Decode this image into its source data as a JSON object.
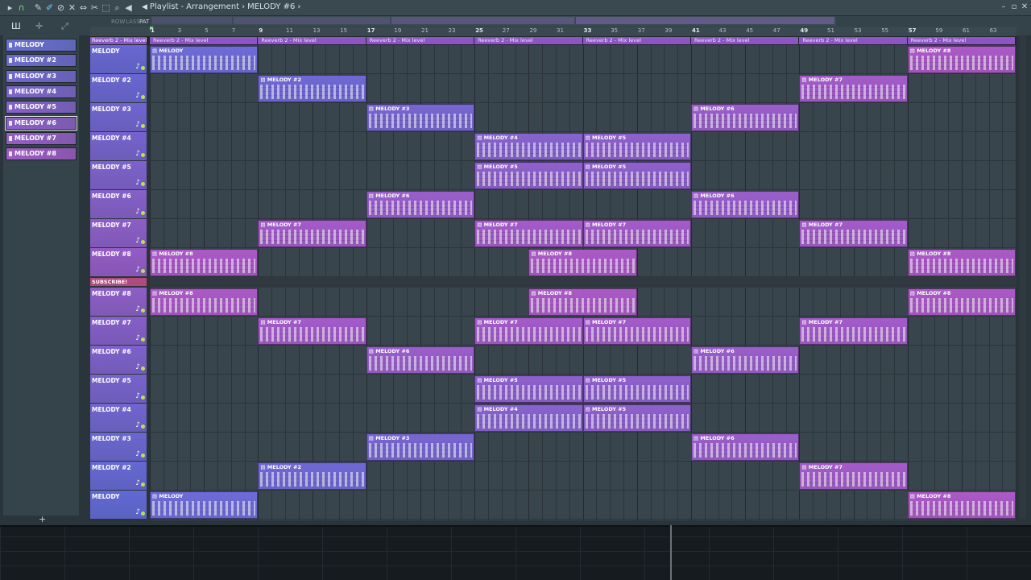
{
  "breadcrumb": {
    "part1": "Playlist",
    "part2": "Arrangement",
    "part3": "MELODY #6"
  },
  "toolbar_labels": {
    "row1a": "ROW",
    "row1b": "LASS",
    "row1c": "PAT"
  },
  "patterns": [
    {
      "label": "MELODY",
      "color": "#6a6fd2"
    },
    {
      "label": "MELODY #2",
      "color": "#6d6bd0"
    },
    {
      "label": "MELODY #3",
      "color": "#7468cf"
    },
    {
      "label": "MELODY #4",
      "color": "#7c66cc"
    },
    {
      "label": "MELODY #5",
      "color": "#8463ca"
    },
    {
      "label": "MELODY #6",
      "color": "#8c61c8",
      "selected": true
    },
    {
      "label": "MELODY #7",
      "color": "#955ec6"
    },
    {
      "label": "MELODY #8",
      "color": "#9e5bc4"
    }
  ],
  "add_button": "+",
  "ruler_ticks": [
    "1",
    "3",
    "5",
    "7",
    "9",
    "11",
    "13",
    "15",
    "17",
    "19",
    "21",
    "23",
    "25",
    "27",
    "29",
    "31",
    "33",
    "35",
    "37",
    "39",
    "41",
    "43",
    "45",
    "47",
    "49",
    "51",
    "53",
    "55",
    "57",
    "59",
    "61",
    "63"
  ],
  "automation_header": "Reeverb 2 - Mix level",
  "automation_clip_label": "Reeverb 2 - Mix level",
  "tracks": [
    {
      "name": "MELODY",
      "color": "#6867d3"
    },
    {
      "name": "MELODY #2",
      "color": "#6a66d2"
    },
    {
      "name": "MELODY #3",
      "color": "#7065cf"
    },
    {
      "name": "MELODY #4",
      "color": "#7663cd"
    },
    {
      "name": "MELODY #5",
      "color": "#7d62cb"
    },
    {
      "name": "MELODY #6",
      "color": "#8560c9"
    },
    {
      "name": "MELODY #7",
      "color": "#8c5ec7"
    },
    {
      "name": "MELODY #8",
      "color": "#945cc5"
    },
    {
      "name": "MELODY #8",
      "color": "#8d5ec7"
    },
    {
      "name": "MELODY #7",
      "color": "#855fc9"
    },
    {
      "name": "MELODY #6",
      "color": "#7e61cb"
    },
    {
      "name": "MELODY #5",
      "color": "#7763cd"
    },
    {
      "name": "MELODY #4",
      "color": "#7165cf"
    },
    {
      "name": "MELODY #3",
      "color": "#6b67d1"
    },
    {
      "name": "MELODY #2",
      "color": "#6668d3"
    },
    {
      "name": "MELODY",
      "color": "#6169d5"
    }
  ],
  "subscribe_label": "SUBSCRIBE!",
  "clips": [
    {
      "track": 0,
      "start": 1,
      "len": 8,
      "label": "MELODY"
    },
    {
      "track": 0,
      "start": 57,
      "len": 8,
      "label": "MELODY #8"
    },
    {
      "track": 1,
      "start": 9,
      "len": 8,
      "label": "MELODY #2"
    },
    {
      "track": 1,
      "start": 49,
      "len": 8,
      "label": "MELODY #7"
    },
    {
      "track": 2,
      "start": 17,
      "len": 8,
      "label": "MELODY #3"
    },
    {
      "track": 2,
      "start": 41,
      "len": 8,
      "label": "MELODY #6"
    },
    {
      "track": 3,
      "start": 25,
      "len": 8,
      "label": "MELODY #4"
    },
    {
      "track": 3,
      "start": 33,
      "len": 8,
      "label": "MELODY #5"
    },
    {
      "track": 4,
      "start": 25,
      "len": 8,
      "label": "MELODY #5"
    },
    {
      "track": 4,
      "start": 33,
      "len": 8,
      "label": "MELODY #5"
    },
    {
      "track": 5,
      "start": 17,
      "len": 8,
      "label": "MELODY #6"
    },
    {
      "track": 5,
      "start": 41,
      "len": 8,
      "label": "MELODY #6"
    },
    {
      "track": 6,
      "start": 9,
      "len": 8,
      "label": "MELODY #7"
    },
    {
      "track": 6,
      "start": 25,
      "len": 8,
      "label": "MELODY #7"
    },
    {
      "track": 6,
      "start": 33,
      "len": 8,
      "label": "MELODY #7"
    },
    {
      "track": 6,
      "start": 49,
      "len": 8,
      "label": "MELODY #7"
    },
    {
      "track": 7,
      "start": 1,
      "len": 8,
      "label": "MELODY #8"
    },
    {
      "track": 7,
      "start": 29,
      "len": 8,
      "label": "MELODY #8"
    },
    {
      "track": 7,
      "start": 57,
      "len": 8,
      "label": "MELODY #8"
    },
    {
      "track": 8,
      "start": 1,
      "len": 8,
      "label": "MELODY #8"
    },
    {
      "track": 8,
      "start": 29,
      "len": 8,
      "label": "MELODY #8"
    },
    {
      "track": 8,
      "start": 57,
      "len": 8,
      "label": "MELODY #8"
    },
    {
      "track": 9,
      "start": 9,
      "len": 8,
      "label": "MELODY #7"
    },
    {
      "track": 9,
      "start": 25,
      "len": 8,
      "label": "MELODY #7"
    },
    {
      "track": 9,
      "start": 33,
      "len": 8,
      "label": "MELODY #7"
    },
    {
      "track": 9,
      "start": 49,
      "len": 8,
      "label": "MELODY #7"
    },
    {
      "track": 10,
      "start": 17,
      "len": 8,
      "label": "MELODY #6"
    },
    {
      "track": 10,
      "start": 41,
      "len": 8,
      "label": "MELODY #6"
    },
    {
      "track": 11,
      "start": 25,
      "len": 8,
      "label": "MELODY #5"
    },
    {
      "track": 11,
      "start": 33,
      "len": 8,
      "label": "MELODY #5"
    },
    {
      "track": 12,
      "start": 25,
      "len": 8,
      "label": "MELODY #4"
    },
    {
      "track": 12,
      "start": 33,
      "len": 8,
      "label": "MELODY #5"
    },
    {
      "track": 13,
      "start": 17,
      "len": 8,
      "label": "MELODY #3"
    },
    {
      "track": 13,
      "start": 41,
      "len": 8,
      "label": "MELODY #6"
    },
    {
      "track": 14,
      "start": 9,
      "len": 8,
      "label": "MELODY #2"
    },
    {
      "track": 14,
      "start": 49,
      "len": 8,
      "label": "MELODY #7"
    },
    {
      "track": 15,
      "start": 1,
      "len": 8,
      "label": "MELODY"
    },
    {
      "track": 15,
      "start": 57,
      "len": 8,
      "label": "MELODY #8"
    }
  ],
  "clip_colors": {
    "MELODY": "#6e6bd8",
    "MELODY #2": "#7068d4",
    "MELODY #3": "#7766d1",
    "MELODY #4": "#8763cf",
    "MELODY #5": "#8f60cd",
    "MELODY #6": "#9a5ecb",
    "MELODY #7": "#a35bc9",
    "MELODY #8": "#ab59c6"
  },
  "automation_clips": [
    1,
    9,
    17,
    25,
    33,
    41,
    49,
    57
  ],
  "icons": [
    "magnet-icon",
    "pencil-icon",
    "brush-icon",
    "delete-icon",
    "mute-icon",
    "slip-icon",
    "slice-icon",
    "select-icon",
    "zoom-icon",
    "playback-icon",
    "speaker-icon"
  ]
}
